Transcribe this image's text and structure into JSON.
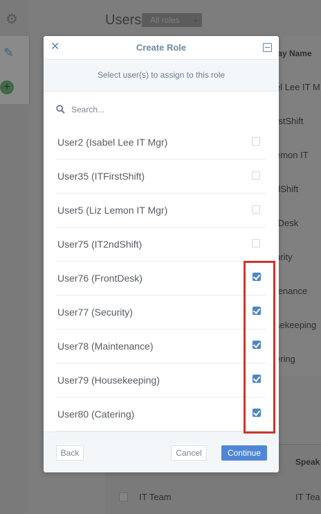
{
  "background": {
    "page_title": "Users",
    "role_filter": "All roles",
    "column_header": "lay Name",
    "column_values": [
      "el Lee IT M",
      "rstShift",
      "emon IT",
      "dShift",
      "tDesk",
      "urity",
      "tenance",
      "sekeeping",
      "ering"
    ],
    "lower_header": "Speak",
    "lower_row_name": "IT Team",
    "lower_row_value": "IT Tea"
  },
  "modal": {
    "title": "Create Role",
    "subtitle": "Select user(s) to assign to this role",
    "search_placeholder": "Search...",
    "users": [
      {
        "name": "User2 (Isabel Lee IT Mgr)",
        "checked": false
      },
      {
        "name": "User35 (ITFirstShift)",
        "checked": false
      },
      {
        "name": "User5 (Liz Lemon IT Mgr)",
        "checked": false
      },
      {
        "name": "User75 (IT2ndShift)",
        "checked": false
      },
      {
        "name": "User76 (FrontDesk)",
        "checked": true
      },
      {
        "name": "User77 (Security)",
        "checked": true
      },
      {
        "name": "User78 (Maintenance)",
        "checked": true
      },
      {
        "name": "User79 (Housekeeping)",
        "checked": true
      },
      {
        "name": "User80 (Catering)",
        "checked": true
      }
    ],
    "back_label": "Back",
    "cancel_label": "Cancel",
    "continue_label": "Continue"
  },
  "colors": {
    "accent": "#4f86d6",
    "highlight": "#c9372c",
    "overlay": "#7d7d7d"
  }
}
